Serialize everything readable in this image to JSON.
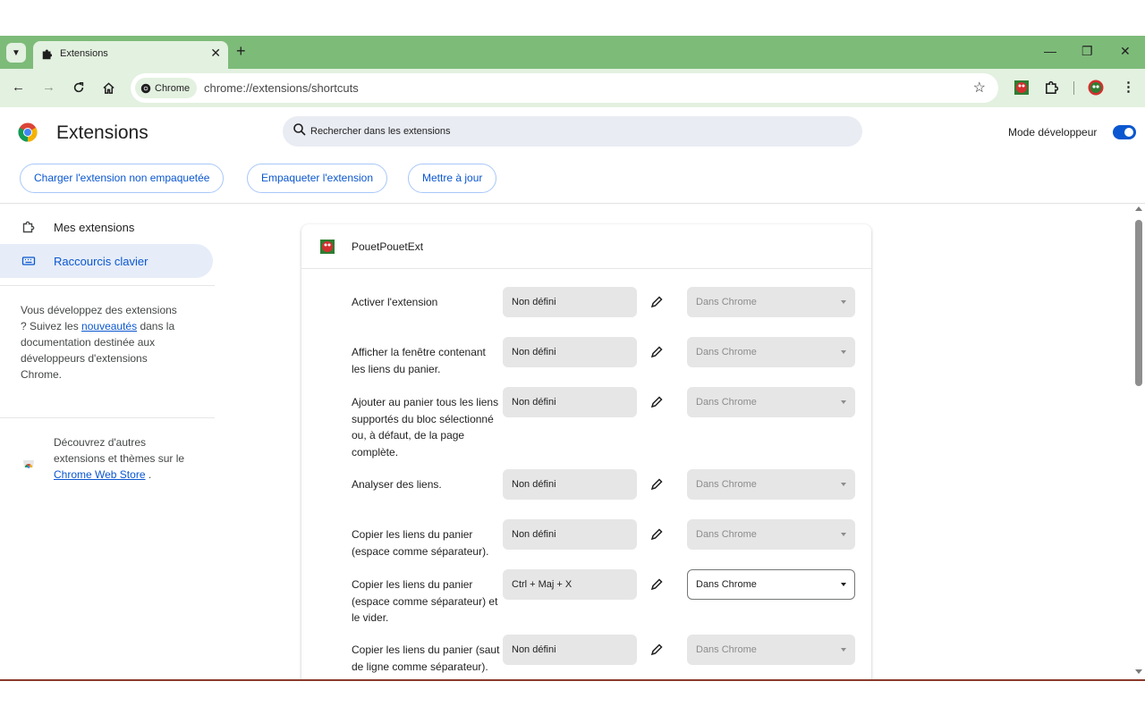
{
  "browser": {
    "tab_title": "Extensions",
    "chip_label": "Chrome",
    "url": "chrome://extensions/shortcuts",
    "theme_color": "#7dbb79"
  },
  "header": {
    "title": "Extensions",
    "search_placeholder": "Rechercher dans les extensions",
    "dev_mode_label": "Mode développeur",
    "dev_mode_on": true,
    "buttons": {
      "load_unpacked": "Charger l'extension non empaquetée",
      "pack": "Empaqueter l'extension",
      "update": "Mettre à jour"
    }
  },
  "sidebar": {
    "items": [
      {
        "label": "Mes extensions"
      },
      {
        "label": "Raccourcis clavier"
      }
    ],
    "dev_text_1": "Vous développez des extensions ? Suivez les ",
    "dev_link": "nouveautés",
    "dev_text_2": " dans la documentation destinée aux développeurs d'extensions Chrome.",
    "store_text_1": "Découvrez d'autres extensions et thèmes sur le ",
    "store_link": "Chrome Web Store",
    "store_text_2": " ."
  },
  "extension": {
    "name": "PouetPouetExt",
    "shortcuts": [
      {
        "label": "Activer l'extension",
        "shortcut": "Non défini",
        "scope": "Dans Chrome"
      },
      {
        "label": "Afficher la fenêtre contenant les liens du panier.",
        "shortcut": "Non défini",
        "scope": "Dans Chrome"
      },
      {
        "label": "Ajouter au panier tous les liens supportés du bloc sélectionné ou, à défaut, de la page complète.",
        "shortcut": "Non défini",
        "scope": "Dans Chrome"
      },
      {
        "label": "Analyser des liens.",
        "shortcut": "Non défini",
        "scope": "Dans Chrome"
      },
      {
        "label": "Copier les liens du panier (espace comme séparateur).",
        "shortcut": "Non défini",
        "scope": "Dans Chrome"
      },
      {
        "label": "Copier les liens du panier (espace comme séparateur) et le vider.",
        "shortcut": "Ctrl + Maj + X",
        "scope": "Dans Chrome"
      },
      {
        "label": "Copier les liens du panier (saut de ligne comme séparateur).",
        "shortcut": "Non défini",
        "scope": "Dans Chrome"
      }
    ]
  }
}
